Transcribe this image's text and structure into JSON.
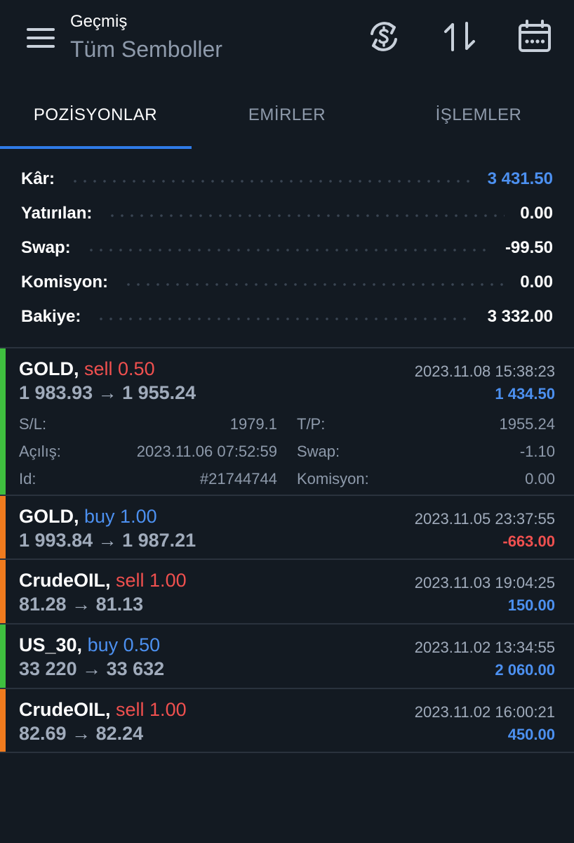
{
  "header": {
    "subtitle": "Geçmiş",
    "title": "Tüm Semboller",
    "icons": [
      "menu-icon",
      "currency-exchange-icon",
      "sort-arrows-icon",
      "calendar-icon"
    ]
  },
  "tabs": [
    {
      "label": "POZİSYONLAR",
      "active": true
    },
    {
      "label": "EMİRLER",
      "active": false
    },
    {
      "label": "İŞLEMLER",
      "active": false
    }
  ],
  "summary": {
    "profit_label": "Kâr:",
    "profit_value": "3 431.50",
    "deposit_label": "Yatırılan:",
    "deposit_value": "0.00",
    "swap_label": "Swap:",
    "swap_value": "-99.50",
    "commission_label": "Komisyon:",
    "commission_value": "0.00",
    "balance_label": "Bakiye:",
    "balance_value": "3 332.00"
  },
  "colors": {
    "background": "#131a22",
    "accent_blue": "#4c90f0",
    "sell_red": "#f0504f",
    "bar_green": "#3fbf3f",
    "bar_orange": "#f07b1e"
  },
  "positions": [
    {
      "symbol": "GOLD,",
      "side": "sell 0.50",
      "prices": "1 983.93 → 1 955.24",
      "date": "2023.11.08 15:38:23",
      "profit": "1 434.50",
      "expanded": true,
      "details": {
        "sl_label": "S/L:",
        "sl_value": "1979.1",
        "tp_label": "T/P:",
        "tp_value": "1955.24",
        "open_label": "Açılış:",
        "open_value": "2023.11.06 07:52:59",
        "swap_label": "Swap:",
        "swap_value": "-1.10",
        "id_label": "Id:",
        "id_value": "#21744744",
        "commission_label": "Komisyon:",
        "commission_value": "0.00"
      }
    },
    {
      "symbol": "GOLD,",
      "side": "buy 1.00",
      "prices": "1 993.84 → 1 987.21",
      "date": "2023.11.05 23:37:55",
      "profit": "-663.00"
    },
    {
      "symbol": "CrudeOIL,",
      "side": "sell 1.00",
      "prices": "81.28 → 81.13",
      "date": "2023.11.03 19:04:25",
      "profit": "150.00"
    },
    {
      "symbol": "US_30,",
      "side": "buy 0.50",
      "prices": "33 220 → 33 632",
      "date": "2023.11.02 13:34:55",
      "profit": "2 060.00"
    },
    {
      "symbol": "CrudeOIL,",
      "side": "sell 1.00",
      "prices": "82.69 → 82.24",
      "date": "2023.11.02 16:00:21",
      "profit": "450.00"
    }
  ]
}
